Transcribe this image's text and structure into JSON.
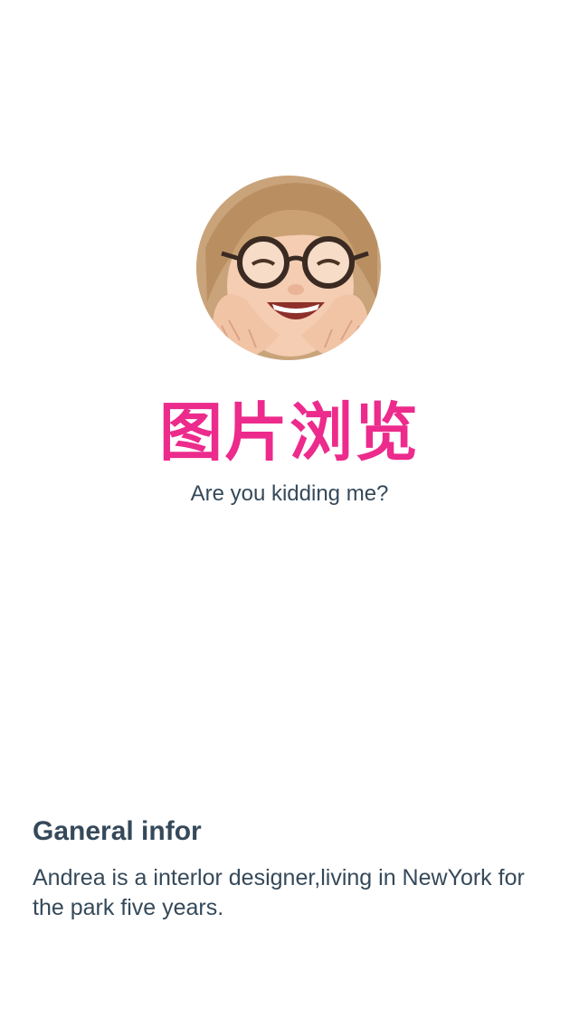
{
  "profile": {
    "avatar_icon": "child-with-glasses-photo",
    "title": "图片浏览",
    "subtitle": "Are you kidding me?"
  },
  "info": {
    "heading": "Ganeral infor",
    "body": "Andrea is a interlor designer,living in NewYork for the park five years."
  },
  "colors": {
    "accent": "#ec2b8c",
    "text": "#35495a",
    "background": "#ffffff"
  }
}
